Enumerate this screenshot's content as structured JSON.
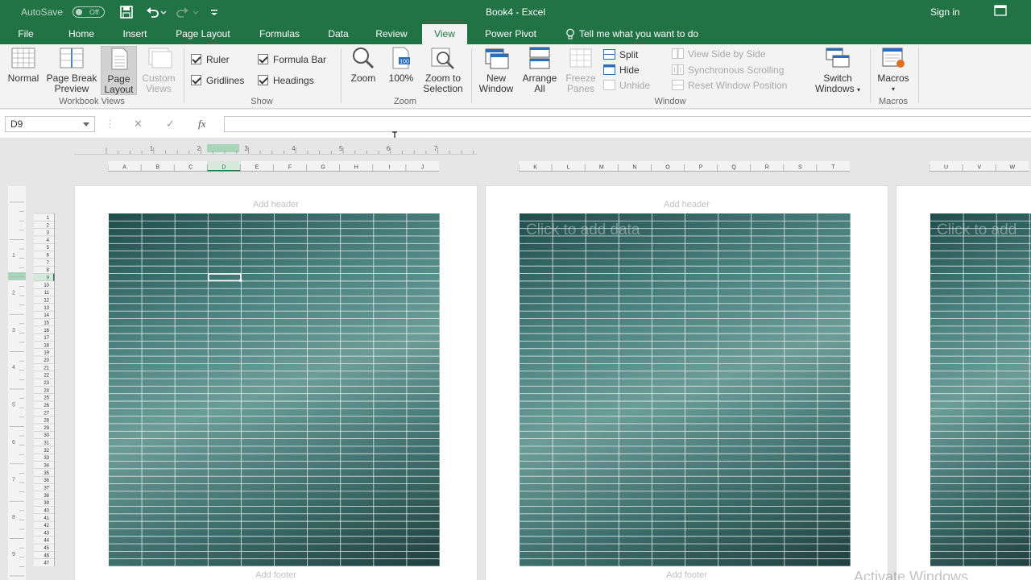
{
  "titlebar": {
    "autosave_label": "AutoSave",
    "autosave_state": "Off",
    "title": "Book4  -  Excel",
    "signin": "Sign in"
  },
  "tabs": [
    {
      "label": "File"
    },
    {
      "label": "Home"
    },
    {
      "label": "Insert"
    },
    {
      "label": "Page Layout"
    },
    {
      "label": "Formulas"
    },
    {
      "label": "Data"
    },
    {
      "label": "Review"
    },
    {
      "label": "View",
      "active": true
    },
    {
      "label": "Power Pivot"
    }
  ],
  "tell_me": "Tell me what you want to do",
  "ribbon": {
    "workbook_views": {
      "label": "Workbook Views",
      "normal": "Normal",
      "page_break_l1": "Page Break",
      "page_break_l2": "Preview",
      "page_layout_l1": "Page",
      "page_layout_l2": "Layout",
      "custom_l1": "Custom",
      "custom_l2": "Views"
    },
    "show": {
      "label": "Show",
      "ruler": "Ruler",
      "formula_bar": "Formula Bar",
      "gridlines": "Gridlines",
      "headings": "Headings"
    },
    "zoom": {
      "label": "Zoom",
      "zoom": "Zoom",
      "hundred": "100%",
      "zoom_sel_l1": "Zoom to",
      "zoom_sel_l2": "Selection"
    },
    "window": {
      "label": "Window",
      "new_l1": "New",
      "new_l2": "Window",
      "arrange_l1": "Arrange",
      "arrange_l2": "All",
      "freeze_l1": "Freeze",
      "freeze_l2": "Panes",
      "split": "Split",
      "hide": "Hide",
      "unhide": "Unhide",
      "side_by_side": "View Side by Side",
      "sync_scroll": "Synchronous Scrolling",
      "reset_pos": "Reset Window Position",
      "switch_l1": "Switch",
      "switch_l2": "Windows"
    },
    "macros": {
      "label": "Macros",
      "macros": "Macros"
    }
  },
  "formula_bar": {
    "name_box": "D9",
    "fx": "fx",
    "value": ""
  },
  "sheet": {
    "ruler_numbers": [
      "1",
      "2",
      "3",
      "4",
      "5",
      "6",
      "7"
    ],
    "vruler_numbers": [
      "1",
      "2",
      "3",
      "4",
      "5",
      "6",
      "7",
      "8",
      "9"
    ],
    "page1_columns": [
      "A",
      "B",
      "C",
      "D",
      "E",
      "F",
      "G",
      "H",
      "I",
      "J"
    ],
    "page2_columns": [
      "K",
      "L",
      "M",
      "N",
      "O",
      "P",
      "Q",
      "R",
      "S",
      "T"
    ],
    "page3_columns": [
      "U",
      "V",
      "W"
    ],
    "rows": 47,
    "selected_cell": "D9",
    "add_header": "Add header",
    "add_footer": "Add footer",
    "click_to_add": "Click to add data",
    "click_to_add_partial": "Click to add"
  },
  "watermark": "Activate Windows",
  "colors": {
    "excel_green": "#217346",
    "ribbon_bg": "#f3f3f3",
    "sheet_bg": "#e6e6e6"
  }
}
